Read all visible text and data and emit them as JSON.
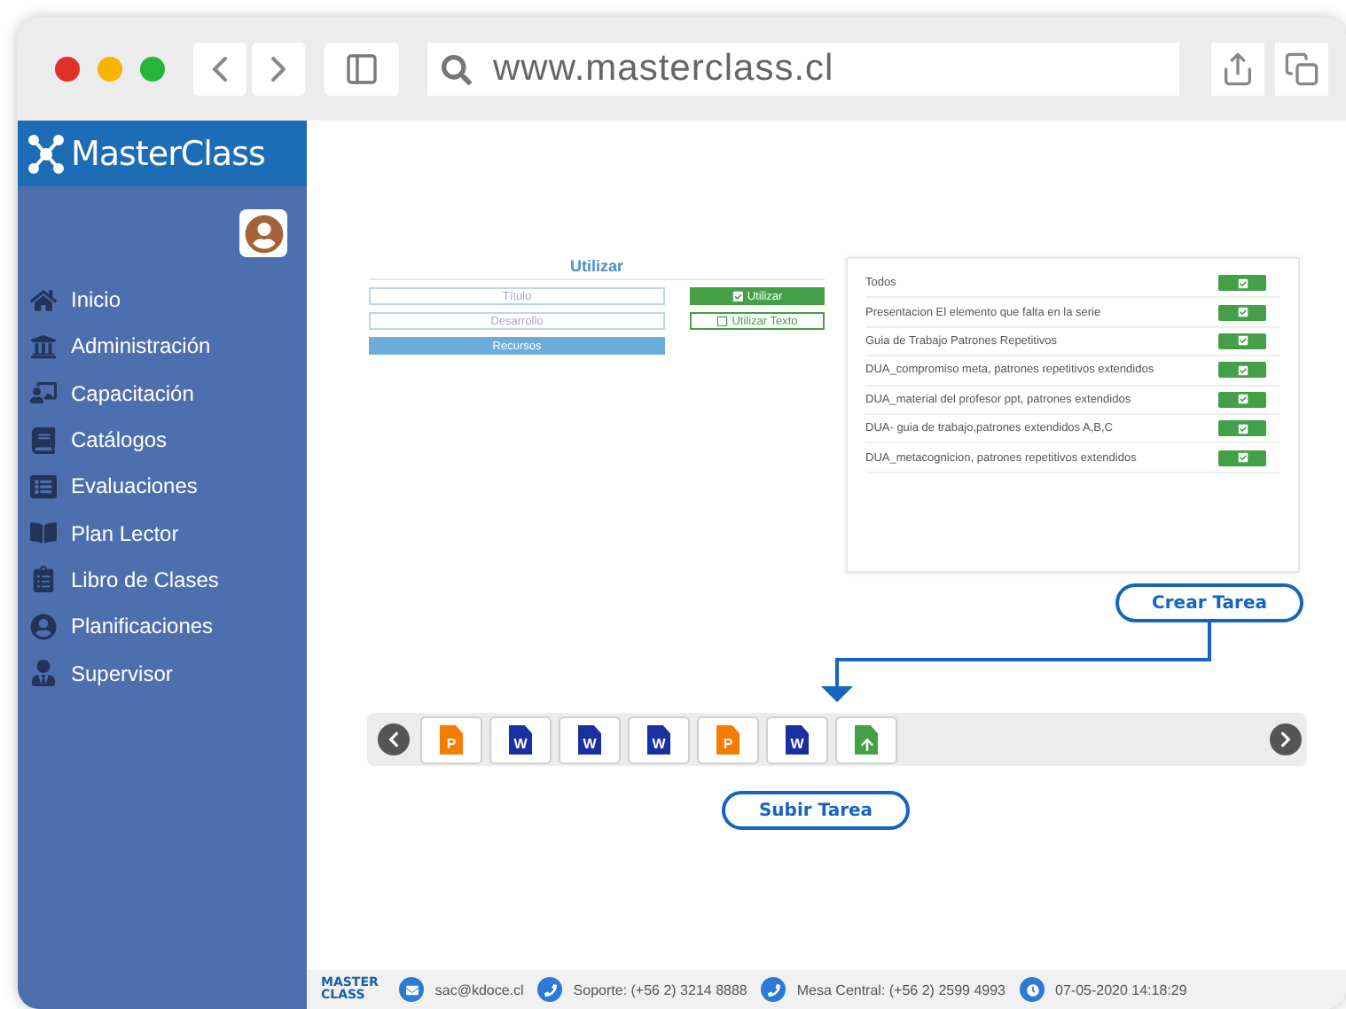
{
  "browser": {
    "url": "www.masterclass.cl"
  },
  "sidebar": {
    "brand": "MasterClass",
    "items": [
      {
        "label": "Inicio"
      },
      {
        "label": "Administración"
      },
      {
        "label": "Capacitación"
      },
      {
        "label": "Catálogos"
      },
      {
        "label": "Evaluaciones"
      },
      {
        "label": "Plan Lector"
      },
      {
        "label": "Libro de Clases"
      },
      {
        "label": "Planificaciones"
      },
      {
        "label": "Supervisor"
      }
    ]
  },
  "form": {
    "title": "Utilizar",
    "fields": [
      {
        "placeholder": "Título"
      },
      {
        "placeholder": "Desarrollo"
      }
    ],
    "resources_button": "Recursos",
    "toggles": [
      {
        "label": "Utilizar",
        "checked": true
      },
      {
        "label": "Utilizar Texto",
        "checked": false
      }
    ]
  },
  "resources": [
    {
      "label": "Todos"
    },
    {
      "label": "Presentacion El elemento que falta en la serie"
    },
    {
      "label": "Guia de Trabajo Patrones Repetitivos"
    },
    {
      "label": "DUA_compromiso meta, patrones repetitivos extendidos"
    },
    {
      "label": "DUA_material del profesor ppt, patrones extendidos"
    },
    {
      "label": "DUA- guia de trabajo,patrones extendidos A,B,C"
    },
    {
      "label": "DUA_metacognicion, patrones repetitivos extendidos"
    }
  ],
  "create_button": "Crear Tarea",
  "files": [
    {
      "kind": "ppt",
      "letter": "P"
    },
    {
      "kind": "word",
      "letter": "W"
    },
    {
      "kind": "word",
      "letter": "W"
    },
    {
      "kind": "word",
      "letter": "W"
    },
    {
      "kind": "ppt",
      "letter": "P"
    },
    {
      "kind": "word",
      "letter": "W"
    },
    {
      "kind": "upload"
    }
  ],
  "upload_button": "Subir Tarea",
  "footer": {
    "brand_top": "MASTER",
    "brand_bottom": "CLASS",
    "email": "sac@kdoce.cl",
    "support": "Soporte: (+56 2) 3214 8888",
    "central": "Mesa Central: (+56 2) 2599 4993",
    "datetime": "07-05-2020 14:18:29"
  }
}
